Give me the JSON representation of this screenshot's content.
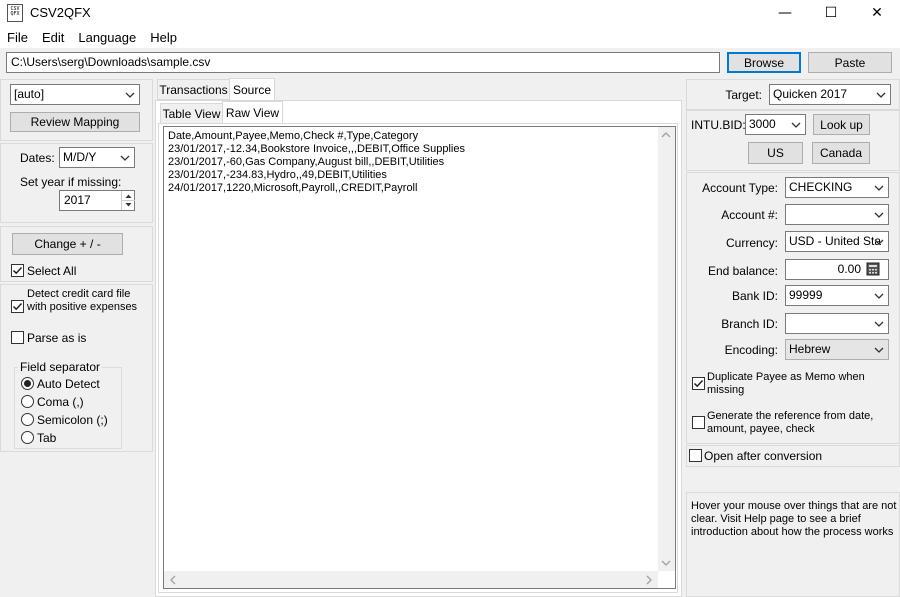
{
  "window": {
    "title": "CSV2QFX",
    "icon_text": "CSV QFX",
    "minimize_glyph": "—",
    "maximize_glyph": "☐",
    "close_glyph": "✕"
  },
  "menu": [
    "File",
    "Edit",
    "Language",
    "Help"
  ],
  "file_path": "C:\\Users\\serg\\Downloads\\sample.csv",
  "buttons": {
    "browse": "Browse",
    "paste": "Paste",
    "review_mapping": "Review Mapping",
    "change_sign": "Change + / -",
    "look_up": "Look up",
    "us": "US",
    "canada": "Canada"
  },
  "left": {
    "mapping_select": "[auto]",
    "dates_label": "Dates:",
    "dates_format": "M/D/Y",
    "set_year_label": "Set year if missing:",
    "year_value": "2017",
    "select_all": "Select All",
    "detect_credit": "Detect credit card file with positive expenses",
    "parse_as_is": "Parse as is",
    "field_separator_label": "Field separator",
    "separators": [
      "Auto Detect",
      "Coma (,)",
      "Semicolon (;)",
      "Tab"
    ]
  },
  "tabs": {
    "outer": [
      "Transactions",
      "Source"
    ],
    "inner": [
      "Table View",
      "Raw View"
    ]
  },
  "source_lines": [
    "Date,Amount,Payee,Memo,Check #,Type,Category",
    "23/01/2017,-12.34,Bookstore Invoice,,,DEBIT,Office Supplies",
    "23/01/2017,-60,Gas Company,August bill,,DEBIT,Utilities",
    "23/01/2017,-234.83,Hydro,,49,DEBIT,Utilities",
    "24/01/2017,1220,Microsoft,Payroll,,CREDIT,Payroll"
  ],
  "right": {
    "target_label": "Target:",
    "target_value": "Quicken 2017",
    "intu_label": "INTU.BID:",
    "intu_value": "3000",
    "account_type_label": "Account Type:",
    "account_type_value": "CHECKING",
    "account_num_label": "Account #:",
    "account_num_value": "",
    "currency_label": "Currency:",
    "currency_value": "USD - United Sta",
    "end_balance_label": "End balance:",
    "end_balance_value": "0.00",
    "bank_id_label": "Bank ID:",
    "bank_id_value": "99999",
    "branch_id_label": "Branch ID:",
    "branch_id_value": "",
    "encoding_label": "Encoding:",
    "encoding_value": "Hebrew",
    "dup_payee": "Duplicate Payee as Memo when missing",
    "gen_ref": "Generate the reference from date, amount, payee, check",
    "open_after": "Open after conversion",
    "hint": "Hover your mouse over things that are not clear. Visit Help page to see a brief introduction about how the process works"
  },
  "checkbox_states": {
    "select_all": true,
    "detect_credit": true,
    "parse_as_is": false,
    "dup_payee": true,
    "gen_ref": false,
    "open_after": false
  },
  "selected_separator": "Auto Detect"
}
